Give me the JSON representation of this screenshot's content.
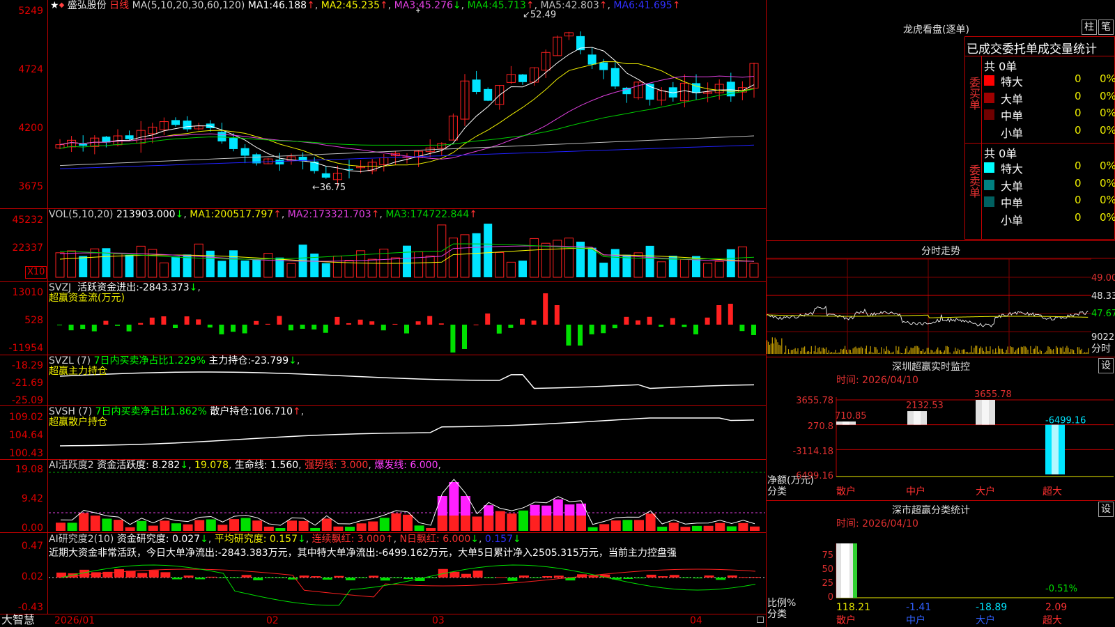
{
  "colors": {
    "up": "#ff2020",
    "down": "#00e5ff",
    "frame": "#c00000",
    "bg": "#000000",
    "ma1": "#ffffff",
    "ma2": "#f0f000",
    "ma3": "#e040e0",
    "ma4": "#00d000",
    "ma5": "#c0c0c0",
    "ma6": "#2020ff"
  },
  "main": {
    "stock": "盛弘股份",
    "period": "日线",
    "ma_header": "MA(5,10,20,30,60,120)",
    "ma": [
      {
        "k": "MA1:",
        "v": "46.188"
      },
      {
        "k": "MA2:",
        "v": "45.235"
      },
      {
        "k": "MA3:",
        "v": "45.276"
      },
      {
        "k": "MA4:",
        "v": "45.713"
      },
      {
        "k": "MA5:",
        "v": "42.803"
      },
      {
        "k": "MA6:",
        "v": "41.695"
      }
    ],
    "y_ticks": [
      "5249",
      "4724",
      "4200",
      "3675"
    ],
    "high_label": "52.49",
    "low_label": "←36.75"
  },
  "vol": {
    "header": "VOL(5,10,20)",
    "value": "213903.000",
    "ma": [
      {
        "k": "MA1:",
        "v": "200517.797"
      },
      {
        "k": "MA2:",
        "v": "173321.703"
      },
      {
        "k": "MA3:",
        "v": "174722.844"
      }
    ],
    "y_ticks": [
      "45232",
      "22337"
    ],
    "unit": "X10"
  },
  "svzj": {
    "header": "SVZJ",
    "t1": "活跃资金进出:",
    "v1": "-2843.373",
    "sub": "超赢资金流(万元)",
    "y_ticks": [
      "13010",
      "528",
      "-11954"
    ]
  },
  "svzl": {
    "header": "SVZL (7)",
    "t1": "7日内买卖净占比1.229%",
    "t2": "主力持仓:",
    "v2": "-23.799",
    "sub": "超赢主力持仓",
    "y_ticks": [
      "-18.29",
      "-21.69",
      "-25.09"
    ]
  },
  "svsh": {
    "header": "SVSH (7)",
    "t1": "7日内买卖净占比1.862%",
    "t2": "散户持仓:",
    "v2": "106.710",
    "sub": "超赢散户持仓",
    "y_ticks": [
      "109.02",
      "104.64",
      "100.43"
    ]
  },
  "ai1": {
    "header": "AI活跃度2",
    "t1": "资金活跃度:",
    "v1": "8.282",
    "v2": "19.078",
    "t3": "生命线:",
    "v3": "1.560",
    "t4": "强势线:",
    "v4": "3.000",
    "t5": "爆发线:",
    "v5": "6.000",
    "y_ticks": [
      "19.08",
      "9.42",
      "0.00"
    ]
  },
  "ai2": {
    "header": "AI研究度2(10)",
    "t1": "资金研究度:",
    "v1": "0.027",
    "t2": "平均研究度:",
    "v2": "0.157",
    "t3": "连续飘红:",
    "v3": "3.000",
    "t4": "N日飘红:",
    "v4": "6.000",
    "v5": "0.157",
    "comment": "近期大资金非常活跃，今日大单净流出:-2843.383万元，其中特大单净流出:-6499.162万元，大单5日累计净入2505.315万元，当前主力控盘强",
    "y_ticks": [
      "0.47",
      "0.02",
      "-0.43"
    ]
  },
  "bottom": {
    "brand": "大智慧",
    "dates": [
      "2026/01",
      "02",
      "03",
      "04"
    ]
  },
  "dragon": {
    "title": "龙虎看盘(逐单)",
    "btn1": "柱",
    "btn2": "笔",
    "stat_title": "已成交委托单成交量统计",
    "buy": {
      "side": "委买单",
      "total": "共 0单",
      "rows": [
        {
          "name": "特大",
          "n": "0",
          "p": "0%"
        },
        {
          "name": "大单",
          "n": "0",
          "p": "0%"
        },
        {
          "name": "中单",
          "n": "0",
          "p": "0%"
        },
        {
          "name": "小单",
          "n": "0",
          "p": "0%"
        }
      ]
    },
    "sell": {
      "side": "委卖单",
      "total": "共 0单",
      "rows": [
        {
          "name": "特大",
          "n": "0",
          "p": "0%"
        },
        {
          "name": "大单",
          "n": "0",
          "p": "0%"
        },
        {
          "name": "中单",
          "n": "0",
          "p": "0%"
        },
        {
          "name": "小单",
          "n": "0",
          "p": "0%"
        }
      ]
    }
  },
  "intraday": {
    "title": "分时走势",
    "y_ticks": [
      "49.00",
      "48.33",
      "47.67"
    ],
    "vol_tick": "9022",
    "unit": "分时"
  },
  "szmon": {
    "title": "深圳超赢实时监控",
    "btn": "设",
    "date": "时间: 2026/04/10",
    "y_ticks": [
      "3655.78",
      "270.8",
      "-3114.18",
      "-6499.16"
    ],
    "ylabel": "净额(万元)",
    "xlabel": "分类",
    "cats": [
      "散户",
      "中户",
      "大户",
      "超大"
    ],
    "vals": [
      710.85,
      2132.53,
      3655.78,
      -6499.16
    ],
    "val_labels": [
      "710.85",
      "2132.53",
      "3655.78",
      "-6499.16"
    ]
  },
  "szcls": {
    "title": "深市超赢分类统计",
    "btn": "设",
    "date": "时间: 2026/04/10",
    "y_ticks": [
      "75",
      "50",
      "25",
      "0"
    ],
    "ylabel": "比例%",
    "xlabel": "分类",
    "cats": [
      "散户",
      "中户",
      "大户",
      "超大"
    ],
    "vals": [
      "118.21",
      "-1.41",
      "-18.89",
      "2.09"
    ],
    "extra": "-0.51%"
  },
  "chart_data": {
    "type": "bar",
    "categories": [
      "散户",
      "中户",
      "大户",
      "超大"
    ],
    "values": [
      710.85,
      2132.53,
      3655.78,
      -6499.16
    ],
    "title": "深圳超赢实时监控",
    "ylabel": "净额(万元)",
    "xlabel": "分类",
    "ylim": [
      -6499.16,
      3655.78
    ]
  }
}
